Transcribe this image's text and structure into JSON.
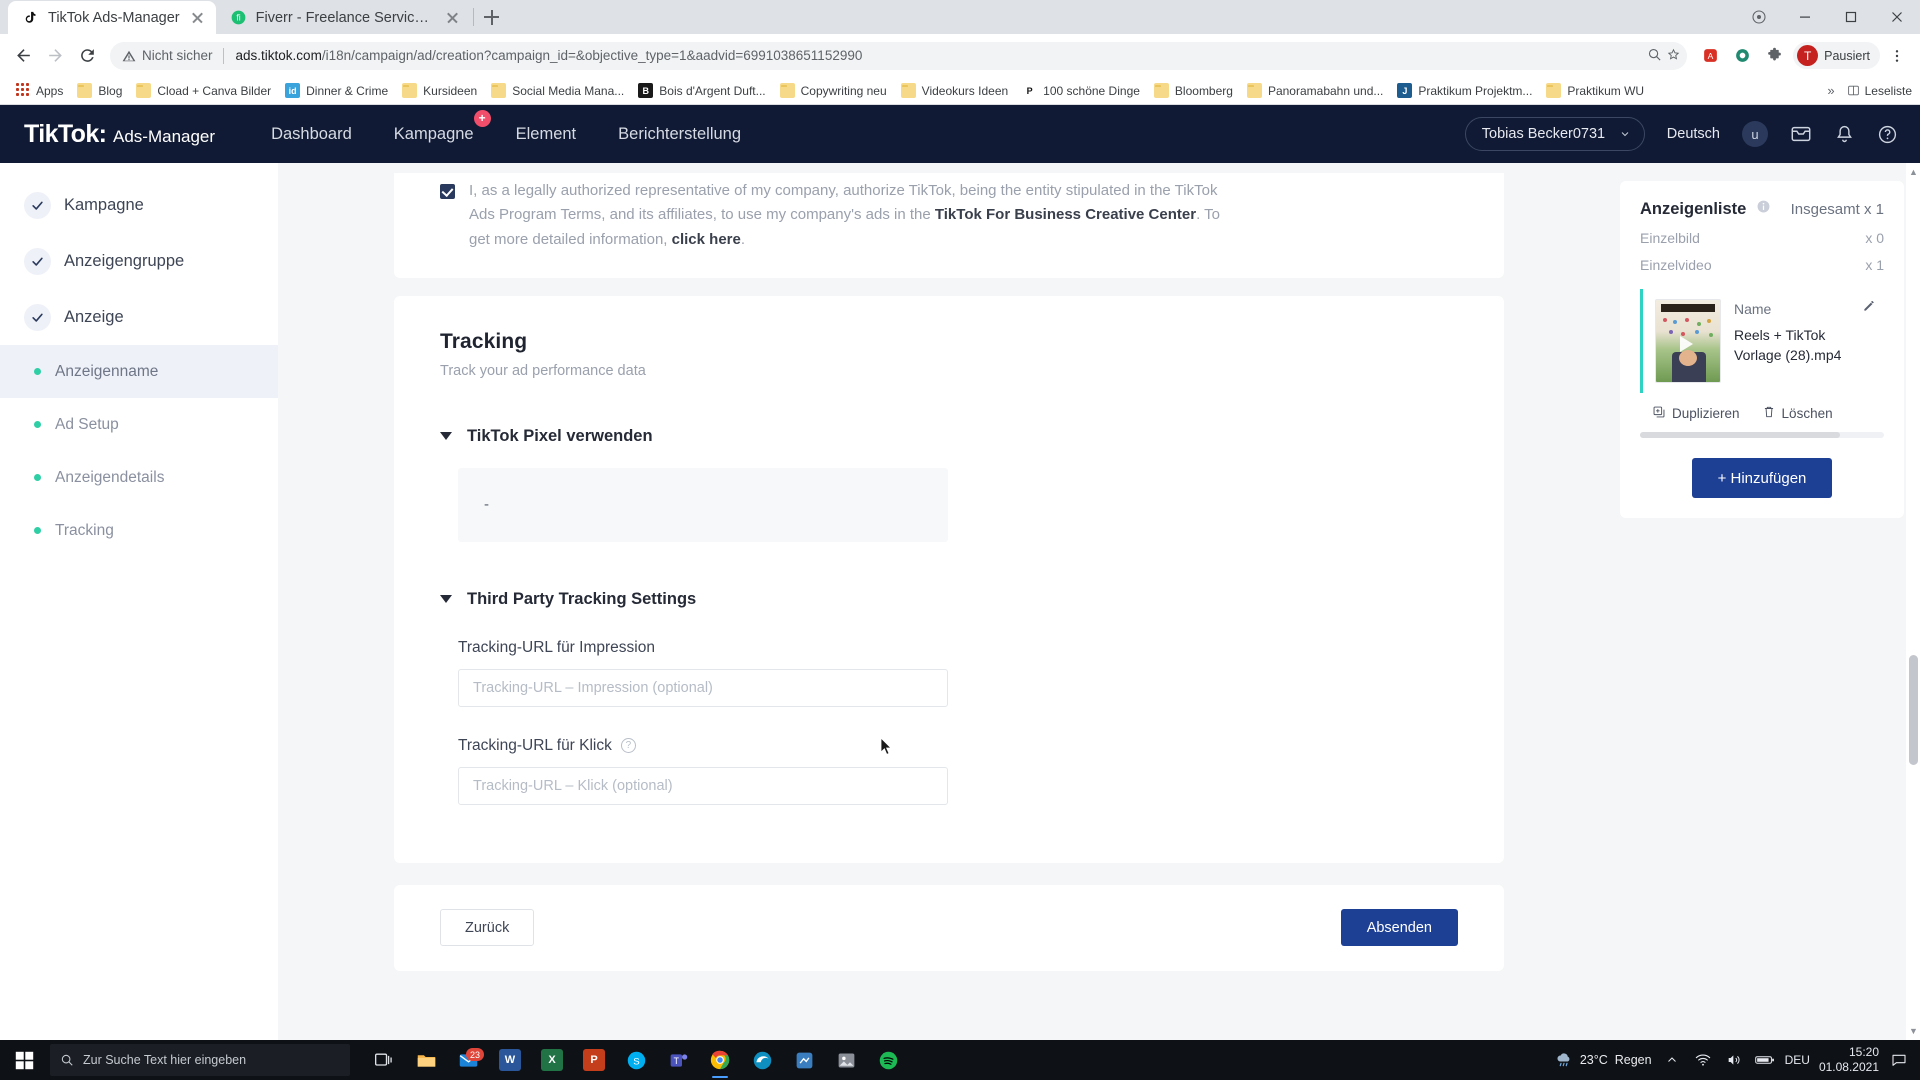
{
  "browser": {
    "tabs": [
      {
        "title": "TikTok Ads-Manager",
        "favicon": "tiktok-icon",
        "active": true
      },
      {
        "title": "Fiverr - Freelance Services Marke",
        "favicon": "fiverr-icon",
        "active": false
      }
    ],
    "newtab_label": "+",
    "window_controls": {
      "minimize": "minimize-icon",
      "maximize": "maximize-icon",
      "close": "close-icon"
    },
    "omnibox": {
      "security_label": "Nicht sicher",
      "url_domain": "ads.tiktok.com",
      "url_path": "/i18n/campaign/ad/creation?campaign_id=&objective_type=1&aadvid=699103865115299",
      "url_tail": "0"
    },
    "profile": {
      "initial": "T",
      "label": "Pausiert"
    },
    "bookmarks": [
      {
        "label": "Apps",
        "icon": "apps-grid-icon"
      },
      {
        "label": "Blog",
        "icon": "folder-icon"
      },
      {
        "label": "Cload + Canva Bilder",
        "icon": "folder-icon"
      },
      {
        "label": "Dinner & Crime",
        "icon": "id-icon"
      },
      {
        "label": "Kursideen",
        "icon": "folder-icon"
      },
      {
        "label": "Social Media Mana...",
        "icon": "folder-icon"
      },
      {
        "label": "Bois d'Argent Duft...",
        "icon": "dark-site-icon"
      },
      {
        "label": "Copywriting neu",
        "icon": "folder-icon"
      },
      {
        "label": "Videokurs Ideen",
        "icon": "folder-icon"
      },
      {
        "label": "100 schöne Dinge",
        "icon": "p-site-icon"
      },
      {
        "label": "Bloomberg",
        "icon": "folder-icon"
      },
      {
        "label": "Panoramabahn und...",
        "icon": "folder-icon"
      },
      {
        "label": "Praktikum Projektm...",
        "icon": "j-site-icon"
      },
      {
        "label": "Praktikum WU",
        "icon": "folder-icon"
      }
    ],
    "bookmarks_overflow": "»",
    "reading_list": "Leseliste"
  },
  "app_header": {
    "logo_main": "TikTok",
    "logo_colon": ":",
    "logo_sub": "Ads-Manager",
    "nav": [
      {
        "label": "Dashboard",
        "badge": null
      },
      {
        "label": "Kampagne",
        "badge": "+"
      },
      {
        "label": "Element",
        "badge": null
      },
      {
        "label": "Berichterstellung",
        "badge": null
      }
    ],
    "account": "Tobias Becker0731",
    "account_chevron": "chevron-down-icon",
    "language": "Deutsch",
    "avatar_initial": "u",
    "icons": [
      "inbox-icon",
      "bell-icon",
      "help-icon"
    ]
  },
  "sidebar": {
    "steps": [
      {
        "label": "Kampagne",
        "state": "done"
      },
      {
        "label": "Anzeigengruppe",
        "state": "done"
      },
      {
        "label": "Anzeige",
        "state": "done"
      }
    ],
    "substeps": [
      {
        "label": "Anzeigenname",
        "active": true
      },
      {
        "label": "Ad Setup",
        "active": false
      },
      {
        "label": "Anzeigendetails",
        "active": false
      },
      {
        "label": "Tracking",
        "active": false
      }
    ]
  },
  "consent": {
    "line1": "I, as a legally authorized representative of my company, authorize TikTok, being the entity stipulated in the TikTok Ads",
    "line2_pre": "Program Terms, and its affiliates, to use my company's ads in the ",
    "line2_link": "TikTok For Business Creative Center",
    "line2_post": ". To get more detailed",
    "line3_pre": "information, ",
    "line3_link": "click here",
    "line3_post": "."
  },
  "tracking": {
    "title": "Tracking",
    "subtitle": "Track your ad performance data",
    "pixel_section": {
      "title": "TikTok Pixel verwenden",
      "value": "-"
    },
    "third_party_section": {
      "title": "Third Party Tracking Settings"
    },
    "impression": {
      "label": "Tracking-URL für Impression",
      "placeholder": "Tracking-URL – Impression (optional)",
      "value": ""
    },
    "click": {
      "label": "Tracking-URL für Klick",
      "help_icon": "question-mark-icon",
      "placeholder": "Tracking-URL – Klick (optional)",
      "value": ""
    }
  },
  "footer": {
    "back_label": "Zurück",
    "submit_label": "Absenden"
  },
  "right_panel": {
    "title": "Anzeigenliste",
    "info_icon": "info-icon",
    "total_label": "Insgesamt x 1",
    "counts": [
      {
        "label": "Einzelbild",
        "value": "x 0"
      },
      {
        "label": "Einzelvideo",
        "value": "x 1"
      }
    ],
    "ad": {
      "name_label": "Name",
      "edit_icon": "pencil-icon",
      "filename": "Reels + TikTok Vorlage (28).mp4",
      "actions": [
        {
          "label": "Duplizieren",
          "icon": "duplicate-icon"
        },
        {
          "label": "Löschen",
          "icon": "trash-icon"
        }
      ]
    },
    "add_label": "+ Hinzufügen"
  },
  "taskbar": {
    "search_placeholder": "Zur Suche Text hier eingeben",
    "apps": [
      {
        "name": "task-view-icon",
        "label": "",
        "color": "#2b3038"
      },
      {
        "name": "file-explorer-icon",
        "label": "",
        "color": "#f7b64a"
      },
      {
        "name": "mail-icon",
        "label": "",
        "color": "#1b84d8",
        "badge": "23"
      },
      {
        "name": "word-icon",
        "label": "W",
        "color": "#2b579a"
      },
      {
        "name": "excel-icon",
        "label": "X",
        "color": "#217346"
      },
      {
        "name": "powerpoint-icon",
        "label": "P",
        "color": "#c43e1c"
      },
      {
        "name": "skype-icon",
        "label": "",
        "color": "#00aff0"
      },
      {
        "name": "teams-icon",
        "label": "",
        "color": "#4b53bc"
      },
      {
        "name": "chrome-icon",
        "label": "",
        "color": "#4285f4",
        "running": true
      },
      {
        "name": "edge-icon",
        "label": "",
        "color": "#0f8fbf"
      },
      {
        "name": "app-icon",
        "label": "",
        "color": "#3a7ebf"
      },
      {
        "name": "photos-icon",
        "label": "",
        "color": "#8a8f98"
      },
      {
        "name": "spotify-icon",
        "label": "",
        "color": "#1db954"
      }
    ],
    "weather": {
      "temp": "23°C",
      "condition": "Regen"
    },
    "language": "DEU",
    "time": "15:20",
    "date": "01.08.2021",
    "chevron": "chevron-up-icon"
  }
}
